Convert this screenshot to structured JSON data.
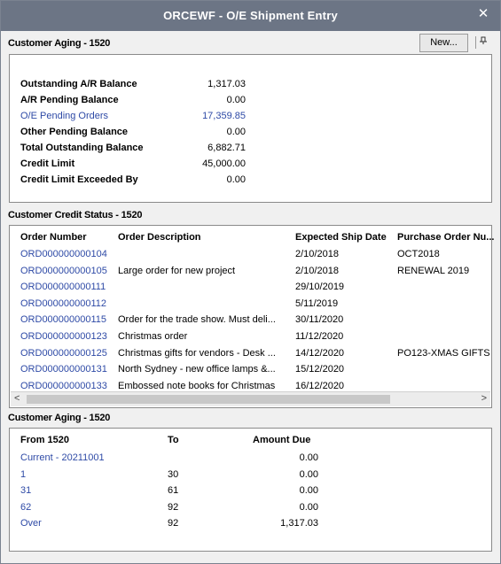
{
  "window": {
    "title": "ORCEWF - O/E Shipment Entry",
    "close_glyph": "✕"
  },
  "aging_top": {
    "section_label": "Customer Aging - 1520",
    "new_button": "New...",
    "pin_icon": "pin-icon",
    "rows": [
      {
        "label": "Outstanding A/R Balance",
        "value": "1,317.03",
        "link": false
      },
      {
        "label": "A/R Pending Balance",
        "value": "0.00",
        "link": false
      },
      {
        "label": "O/E Pending Orders",
        "value": "17,359.85",
        "link": true
      },
      {
        "label": "Other Pending Balance",
        "value": "0.00",
        "link": false
      },
      {
        "label": "Total Outstanding Balance",
        "value": "6,882.71",
        "link": false
      },
      {
        "label": "Credit Limit",
        "value": "45,000.00",
        "link": false
      },
      {
        "label": "Credit Limit Exceeded By",
        "value": "0.00",
        "link": false
      }
    ]
  },
  "credit_status": {
    "section_label": "Customer Credit Status - 1520",
    "columns": [
      "Order Number",
      "Order Description",
      "Expected Ship Date",
      "Purchase Order Nu..."
    ],
    "rows": [
      {
        "order": "ORD000000000104",
        "desc": "",
        "date": "2/10/2018",
        "po": "OCT2018"
      },
      {
        "order": "ORD000000000105",
        "desc": "Large order for new project",
        "date": "2/10/2018",
        "po": "RENEWAL 2019"
      },
      {
        "order": "ORD000000000111",
        "desc": "",
        "date": "29/10/2019",
        "po": ""
      },
      {
        "order": "ORD000000000112",
        "desc": "",
        "date": "5/11/2019",
        "po": ""
      },
      {
        "order": "ORD000000000115",
        "desc": "Order for the trade show.  Must deli...",
        "date": "30/11/2020",
        "po": ""
      },
      {
        "order": "ORD000000000123",
        "desc": "Christmas order",
        "date": "11/12/2020",
        "po": ""
      },
      {
        "order": "ORD000000000125",
        "desc": "Christmas gifts for vendors - Desk ...",
        "date": "14/12/2020",
        "po": "PO123-XMAS GIFTS"
      },
      {
        "order": "ORD000000000131",
        "desc": "North Sydney - new office lamps &...",
        "date": "15/12/2020",
        "po": ""
      },
      {
        "order": "ORD000000000133",
        "desc": "Embossed note books for Christmas",
        "date": "16/12/2020",
        "po": ""
      }
    ],
    "scroll_left": "<",
    "scroll_right": ">"
  },
  "aging_bottom": {
    "section_label": "Customer Aging - 1520",
    "columns": [
      "From 1520",
      "To",
      "Amount Due"
    ],
    "rows": [
      {
        "from": "Current - 20211001",
        "to": "",
        "amount": "0.00"
      },
      {
        "from": "1",
        "to": "30",
        "amount": "0.00"
      },
      {
        "from": "31",
        "to": "61",
        "amount": "0.00"
      },
      {
        "from": "62",
        "to": "92",
        "amount": "0.00"
      },
      {
        "from": "Over",
        "to": "92",
        "amount": "1,317.03"
      }
    ]
  }
}
